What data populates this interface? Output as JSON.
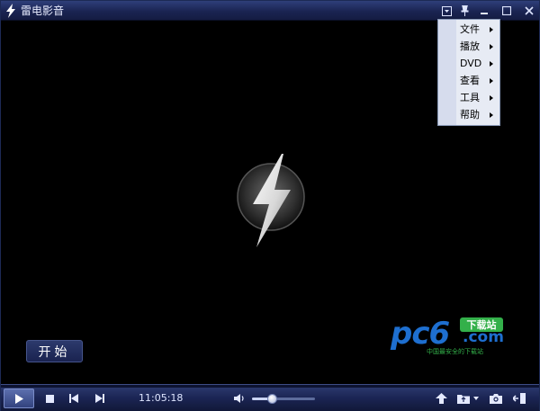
{
  "window": {
    "title": "雷电影音"
  },
  "titlebar": {
    "icons": [
      "menu-dropdown-icon",
      "pin-icon",
      "minimize-icon",
      "maximize-icon",
      "close-icon"
    ]
  },
  "context_menu": {
    "items": [
      {
        "label": "文件",
        "has_submenu": true
      },
      {
        "label": "播放",
        "has_submenu": true
      },
      {
        "label": "DVD",
        "has_submenu": true
      },
      {
        "label": "查看",
        "has_submenu": true
      },
      {
        "label": "工具",
        "has_submenu": true
      },
      {
        "label": "帮助",
        "has_submenu": true
      }
    ]
  },
  "player": {
    "start_label": "开始",
    "logo": "lightning-logo"
  },
  "watermark": {
    "brand": "pc6",
    "badge": "下载站",
    "domain": ".com",
    "tagline": "中国最安全的下载站"
  },
  "controls": {
    "time": "11:05:18",
    "volume_percent": 32,
    "buttons": [
      "play-icon",
      "stop-icon",
      "previous-icon",
      "next-icon"
    ],
    "right_buttons": [
      "eject-icon",
      "open-folder-icon",
      "screenshot-icon",
      "playlist-icon"
    ]
  },
  "colors": {
    "titlebar": "#1a2452",
    "menu_bg": "#e7ebf4",
    "watermark_blue": "#1e6fd0",
    "watermark_green": "#33b04a"
  }
}
